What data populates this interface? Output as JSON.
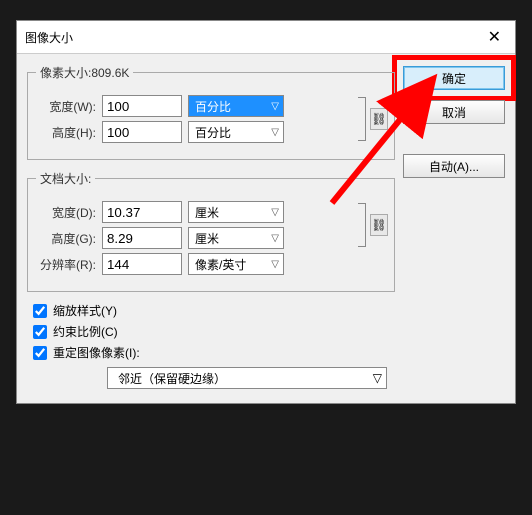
{
  "dialog": {
    "title": "图像大小",
    "close": "✕"
  },
  "pixel": {
    "legend": "像素大小:809.6K",
    "width_label": "宽度(W):",
    "width_value": "100",
    "width_unit": "百分比",
    "height_label": "高度(H):",
    "height_value": "100",
    "height_unit": "百分比",
    "link_icon": "⛓"
  },
  "doc": {
    "legend": "文档大小:",
    "width_label": "宽度(D):",
    "width_value": "10.37",
    "width_unit": "厘米",
    "height_label": "高度(G):",
    "height_value": "8.29",
    "height_unit": "厘米",
    "res_label": "分辨率(R):",
    "res_value": "144",
    "res_unit": "像素/英寸",
    "link_icon": "⛓"
  },
  "checks": {
    "scale": "缩放样式(Y)",
    "constrain": "约束比例(C)",
    "resample": "重定图像像素(I):"
  },
  "resample_method": "邻近（保留硬边缘）",
  "buttons": {
    "ok": "确定",
    "cancel": "取消",
    "auto": "自动(A)..."
  }
}
